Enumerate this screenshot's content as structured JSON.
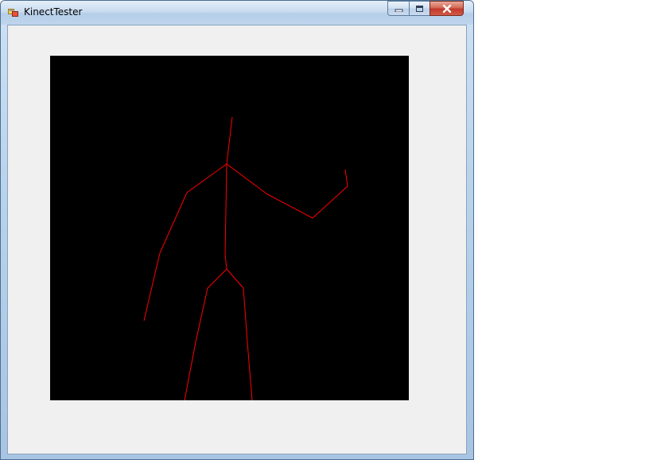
{
  "window": {
    "title": "KinectTester",
    "app_icon": "winforms-app-icon",
    "caption_buttons": [
      {
        "name": "minimize-button",
        "icon": "minimize-icon"
      },
      {
        "name": "maximize-button",
        "icon": "maximize-icon"
      },
      {
        "name": "close-button",
        "icon": "close-icon"
      }
    ]
  },
  "skeleton": {
    "bone_color": "#ff0000",
    "background_color": "#000000"
  },
  "colors": {
    "client_background": "#f0f0f0",
    "frame_accent": "#4a6f93"
  }
}
